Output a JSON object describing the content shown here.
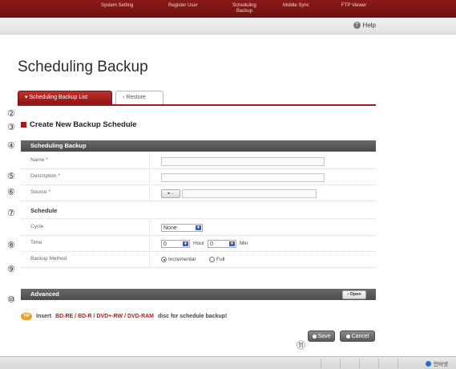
{
  "nav": {
    "items": [
      {
        "label": "System Setting"
      },
      {
        "label": "Register User"
      },
      {
        "label": "Scheduling\nBackup"
      },
      {
        "label": "Mobile Sync"
      },
      {
        "label": "FTP Viewer"
      }
    ],
    "help_label": "Help"
  },
  "page_title": "Scheduling Backup",
  "tabs": [
    {
      "label": "Scheduling Backup List",
      "prefix": "▾"
    },
    {
      "label": "Restore",
      "prefix": "›"
    }
  ],
  "markers": [
    "②",
    "③",
    "④",
    "⑤",
    "⑥",
    "⑦",
    "⑧",
    "⑨",
    "⑩",
    "⑪"
  ],
  "section_title": "Create New Backup Schedule",
  "scheduling_bar": "Scheduling Backup",
  "fields": {
    "name": {
      "label": "Name *",
      "value": ""
    },
    "description": {
      "label": "Description *",
      "value": ""
    },
    "source": {
      "label": "Source *",
      "value": "",
      "browse_label": "▸..."
    }
  },
  "schedule_heading": "Schedule",
  "cycle": {
    "label": "Cycle",
    "value": "None"
  },
  "time": {
    "label": "Time",
    "hour_value": "0",
    "hour_unit": "Hour",
    "min_value": "0",
    "min_unit": "Min"
  },
  "backup_method": {
    "label": "Backup Method",
    "option_incremental": "Incremental",
    "option_full": "Full",
    "selected": "Incremental"
  },
  "advanced_bar": {
    "label": "Advanced",
    "open_label": "› Open"
  },
  "tip": {
    "badge": "TIP",
    "prefix": "Insert",
    "media": "BD-RE / BD-R / DVD+-RW / DVD-RAM",
    "suffix": "disc for schedule backup!"
  },
  "buttons": {
    "save": "Save",
    "cancel": "Cancel"
  },
  "statusbar": {
    "zone": "인터넷"
  }
}
